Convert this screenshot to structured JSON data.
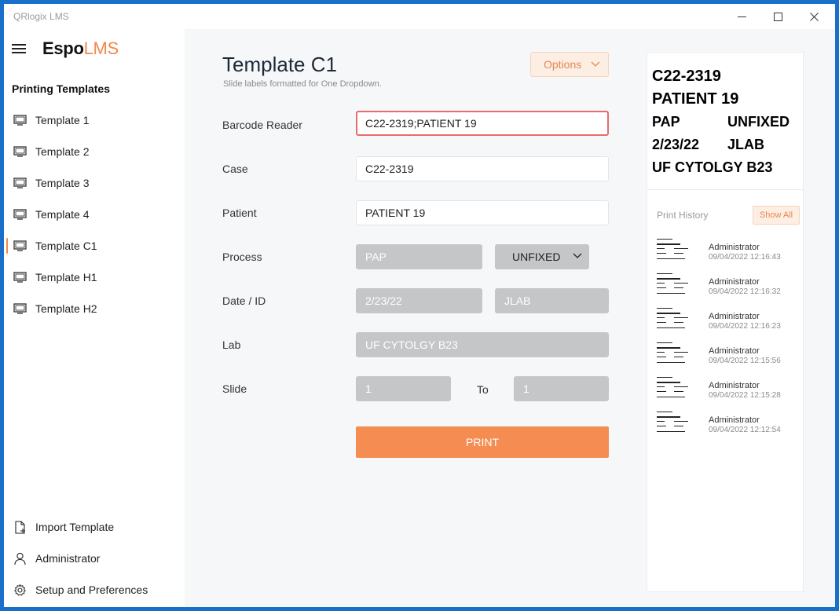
{
  "window": {
    "title": "QRlogix LMS"
  },
  "brand": {
    "part1": "Espo",
    "part2": "LMS"
  },
  "sidebar": {
    "section_title": "Printing Templates",
    "items": [
      {
        "label": "Template 1",
        "icon": "monitor-icon",
        "active": false
      },
      {
        "label": "Template 2",
        "icon": "monitor-icon",
        "active": false
      },
      {
        "label": "Template 3",
        "icon": "monitor-icon",
        "active": false
      },
      {
        "label": "Template 4",
        "icon": "monitor-icon",
        "active": false
      },
      {
        "label": "Template C1",
        "icon": "monitor-icon",
        "active": true
      },
      {
        "label": "Template H1",
        "icon": "monitor-icon",
        "active": false
      },
      {
        "label": "Template H2",
        "icon": "monitor-icon",
        "active": false
      }
    ],
    "bottom": [
      {
        "label": "Import Template",
        "icon": "import-file-icon"
      },
      {
        "label": "Administrator",
        "icon": "user-icon"
      },
      {
        "label": "Setup and Preferences",
        "icon": "gear-icon"
      }
    ]
  },
  "page": {
    "title": "Template C1",
    "subtitle": "Slide labels formatted for One Dropdown.",
    "options_label": "Options"
  },
  "form": {
    "barcode": {
      "label": "Barcode Reader",
      "value": "C22-2319;PATIENT 19"
    },
    "case": {
      "label": "Case",
      "value": "C22-2319"
    },
    "patient": {
      "label": "Patient",
      "value": "PATIENT 19"
    },
    "process": {
      "label": "Process",
      "value": "PAP",
      "select_value": "UNFIXED"
    },
    "date_id": {
      "label": "Date / ID",
      "date": "2/23/22",
      "id": "JLAB"
    },
    "lab": {
      "label": "Lab",
      "value": "UF CYTOLGY B23"
    },
    "slide": {
      "label": "Slide",
      "from": "1",
      "to_label": "To",
      "to": "1"
    },
    "print_label": "PRINT"
  },
  "preview": {
    "line1": "C22-2319",
    "line2": "PATIENT 19",
    "line3_a": "PAP",
    "line3_b": "UNFIXED",
    "line4_a": "2/23/22",
    "line4_b": "JLAB",
    "line5": "UF CYTOLGY B23"
  },
  "history": {
    "title": "Print History",
    "show_all": "Show All",
    "items": [
      {
        "user": "Administrator",
        "time": "09/04/2022 12:16:43"
      },
      {
        "user": "Administrator",
        "time": "09/04/2022 12:16:32"
      },
      {
        "user": "Administrator",
        "time": "09/04/2022 12:16:23"
      },
      {
        "user": "Administrator",
        "time": "09/04/2022 12:15:56"
      },
      {
        "user": "Administrator",
        "time": "09/04/2022 12:15:28"
      },
      {
        "user": "Administrator",
        "time": "09/04/2022 12:12:54"
      }
    ]
  },
  "colors": {
    "accent": "#f58d52",
    "focus_border": "#e96b6b",
    "window_border": "#1a6fc9"
  }
}
